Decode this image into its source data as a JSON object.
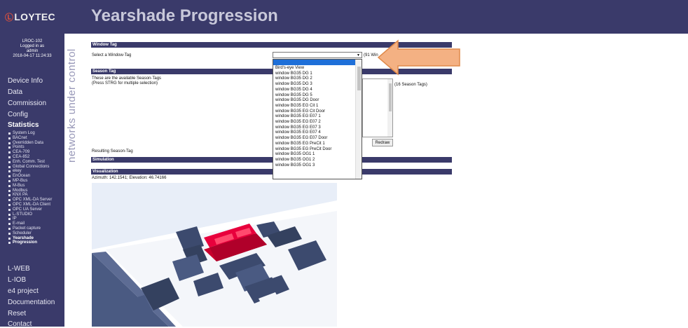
{
  "header": {
    "logo": "LOYTEC",
    "logo_mark": "Ⓛ",
    "title": "Yearshade Progression"
  },
  "login": {
    "device": "LROC-102",
    "logged_in": "Logged in as",
    "user": "admin",
    "datetime": "2018-04-17 11:24:33"
  },
  "vertical_text": "networks under control",
  "nav": {
    "top_items": [
      "Device Info",
      "Data",
      "Commission",
      "Config",
      "Statistics"
    ],
    "sub_items": [
      "System Log",
      "BACnet",
      "Overridden Data",
      "Points",
      "CEA-709",
      "CEA-852",
      "Enh. Comm. Test",
      "Global Connections",
      "ekey",
      "EnOcean",
      "MP-Bus",
      "M-Bus",
      "Modbus",
      "KNX PA",
      "OPC XML-DA Server",
      "OPC XML-DA Client",
      "OPC UA Server",
      "L-STUDIO",
      "IP",
      "E-mail",
      "Packet capture",
      "Scheduler",
      "Yearshade",
      "Progression"
    ],
    "bottom_items": [
      "L-WEB",
      "L-IOB",
      "e4 project",
      "Documentation",
      "Reset",
      "Contact"
    ]
  },
  "window_tag": {
    "section": "Window Tag",
    "label": "Select a Window-Tag",
    "count": "(91 Win",
    "selected": ""
  },
  "dropdown": {
    "options": [
      "Bird's-eye View",
      "window BG35 DG 1",
      "window BG35 DG 2",
      "window BG35 DG 3",
      "window BG35 DG 4",
      "window BG35 DG 5",
      "window BG35 DG Door",
      "window BG35 EG Cit 1",
      "window BG35 EG Cit Door",
      "window BG35 EG E07 1",
      "window BG35 EG E07 2",
      "window BG35 EG E07 3",
      "window BG35 EG E07 4",
      "window BG35 EG E07 Door",
      "window BG35 EG PreCit 1",
      "window BG35 EG PreCit Door",
      "window BG35 OG1 1",
      "window BG35 OG1 2",
      "window BG35 OG1 3"
    ]
  },
  "season_tag": {
    "section": "Season Tag",
    "desc1": "These are the available Season-Tags",
    "desc2": "(Press STRG for multiple selection)",
    "count": "(16 Season Tags)",
    "resulting": "Resulting Season-Tag",
    "redraw": "Redraw"
  },
  "simulation": {
    "section": "Simulation"
  },
  "visualization": {
    "section": "Visualization",
    "info": "Azimuth: 142.1541; Elevation: 46.74166"
  },
  "colors": {
    "navy": "#3a3a6a",
    "highlight": "#1e6fd8",
    "arrow": "#f4b183",
    "building": "#3c4a6e",
    "selected_building": "#e8003c"
  }
}
